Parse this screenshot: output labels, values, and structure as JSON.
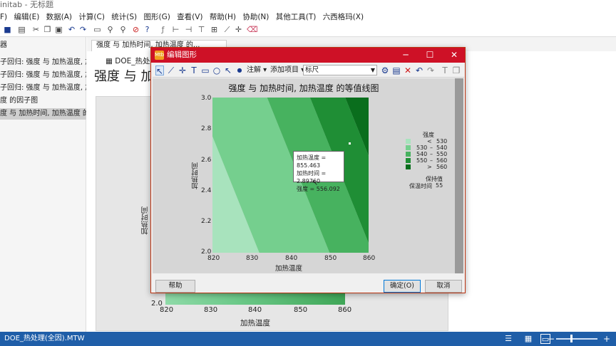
{
  "app": {
    "title": "initab - 无标题"
  },
  "menu": [
    "F)",
    "编辑(E)",
    "数据(A)",
    "计算(C)",
    "统计(S)",
    "图形(G)",
    "查看(V)",
    "帮助(H)",
    "协助(N)",
    "其他工具(T)",
    "六西格玛(X)"
  ],
  "sidebar": {
    "header": "器",
    "items": [
      {
        "label": "子回归: 强度 与 加热温度, 加..."
      },
      {
        "label": "子回归: 强度 与 加热温度, 加..."
      },
      {
        "label": "子回归: 强度 与 加热温度, 加..."
      },
      {
        "label": "度 的因子图"
      },
      {
        "label": "度 与 加热时间, 加热温度 的..."
      }
    ]
  },
  "document": {
    "tab": "强度 与 加热时间, 加热温度 的...",
    "worksheet_title": "DOE_热处理(全",
    "heading": "强度 与 加热",
    "bg_y_label": "加热时间",
    "bg_x_label": "加热温度",
    "bg_y_tick": "2.0",
    "bg_x_ticks": [
      "820",
      "830",
      "840",
      "850",
      "860"
    ]
  },
  "dialog": {
    "title": "编辑图形",
    "icon_text": "Mtb",
    "toolbar": {
      "annotate": "注解 ▾",
      "add_item": "添加项目 ▾",
      "scale_select": "标尺"
    },
    "buttons": {
      "help": "帮助",
      "ok": "确定(O)",
      "cancel": "取消"
    }
  },
  "chart_data": {
    "type": "contour",
    "title": "强度 与 加热时间, 加热温度 的等值线图",
    "xlabel": "加热温度",
    "ylabel": "加热时间",
    "xlim": [
      820,
      860
    ],
    "ylim": [
      2.0,
      3.0
    ],
    "x_ticks": [
      "820",
      "830",
      "840",
      "850",
      "860"
    ],
    "y_ticks": [
      "2.0",
      "2.2",
      "2.4",
      "2.6",
      "2.8",
      "3.0"
    ],
    "legend": {
      "title": "强度",
      "entries": [
        {
          "op": "<",
          "lo": "",
          "hi": "530",
          "color": "#a8e3bd"
        },
        {
          "op": "",
          "lo": "530",
          "hi": "540",
          "color": "#75cf8e"
        },
        {
          "op": "",
          "lo": "540",
          "hi": "550",
          "color": "#47b25f"
        },
        {
          "op": "",
          "lo": "550",
          "hi": "560",
          "color": "#1f8e35"
        },
        {
          "op": ">",
          "lo": "",
          "hi": "560",
          "color": "#0a6e1d"
        }
      ],
      "hold_title": "保持值",
      "hold_label": "保温时间",
      "hold_value": "55"
    },
    "tooltip": {
      "line1": "加热温度 = 855.463",
      "line2": "加热时间 = 2.89760",
      "line3": "强度 = 556.092"
    }
  },
  "status": {
    "file": "DOE_热处理(全因).MTW"
  }
}
